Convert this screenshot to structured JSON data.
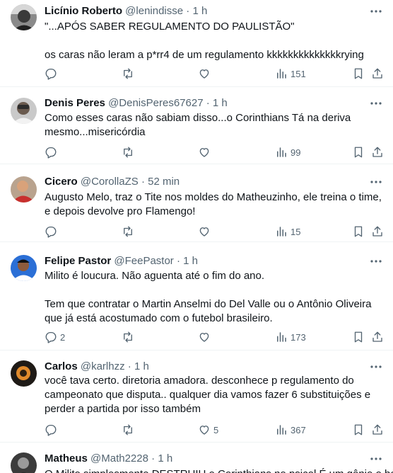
{
  "tweets": [
    {
      "name": "Licínio Roberto",
      "handle": "@lenindisse",
      "separator": "·",
      "time": "1 h",
      "lines": [
        "\"...APÓS SABER REGULAMENTO DO PAULISTÃO\"",
        "os caras não leram a p*rr4 de um regulamento kkkkkkkkkkkkkkrying"
      ],
      "replies": "",
      "retweets": "",
      "likes": "",
      "views": "151"
    },
    {
      "name": "Denis Peres",
      "handle": "@DenisPeres67627",
      "separator": "·",
      "time": "1 h",
      "lines": [
        "Como esses caras não sabiam disso...o Corinthians Tá na deriva mesmo...misericórdia"
      ],
      "replies": "",
      "retweets": "",
      "likes": "",
      "views": "99"
    },
    {
      "name": "Cicero",
      "handle": "@CorollaZS",
      "separator": "·",
      "time": "52 min",
      "lines": [
        "Augusto Melo, traz o Tite nos moldes do Matheuzinho, ele treina o time, e depois devolve pro Flamengo!"
      ],
      "replies": "",
      "retweets": "",
      "likes": "",
      "views": "15"
    },
    {
      "name": "Felipe Pastor",
      "handle": "@FeePastor",
      "separator": "·",
      "time": "1 h",
      "lines": [
        "Milito é loucura. Não aguenta até o fim do ano.",
        "Tem que contratar o Martin Anselmi do Del Valle ou o Antônio Oliveira que já está acostumado com o futebol brasileiro."
      ],
      "replies": "2",
      "retweets": "",
      "likes": "",
      "views": "173"
    },
    {
      "name": "Carlos",
      "handle": "@karlhzz",
      "separator": "·",
      "time": "1 h",
      "lines": [
        "você tava certo. diretoria amadora. desconhece p regulamento do campeonato que disputa.. qualquer dia vamos fazer 6 substituições e perder a partida por isso também"
      ],
      "replies": "",
      "retweets": "",
      "likes": "5",
      "views": "367"
    },
    {
      "name": "Matheus",
      "handle": "@Math2228",
      "separator": "·",
      "time": "1 h",
      "lines": [
        "O Milito simplesmente DESTRUIU o Corinthians no psicol É um gênio o homem"
      ],
      "replies": "",
      "retweets": "",
      "likes": "",
      "views": ""
    }
  ]
}
